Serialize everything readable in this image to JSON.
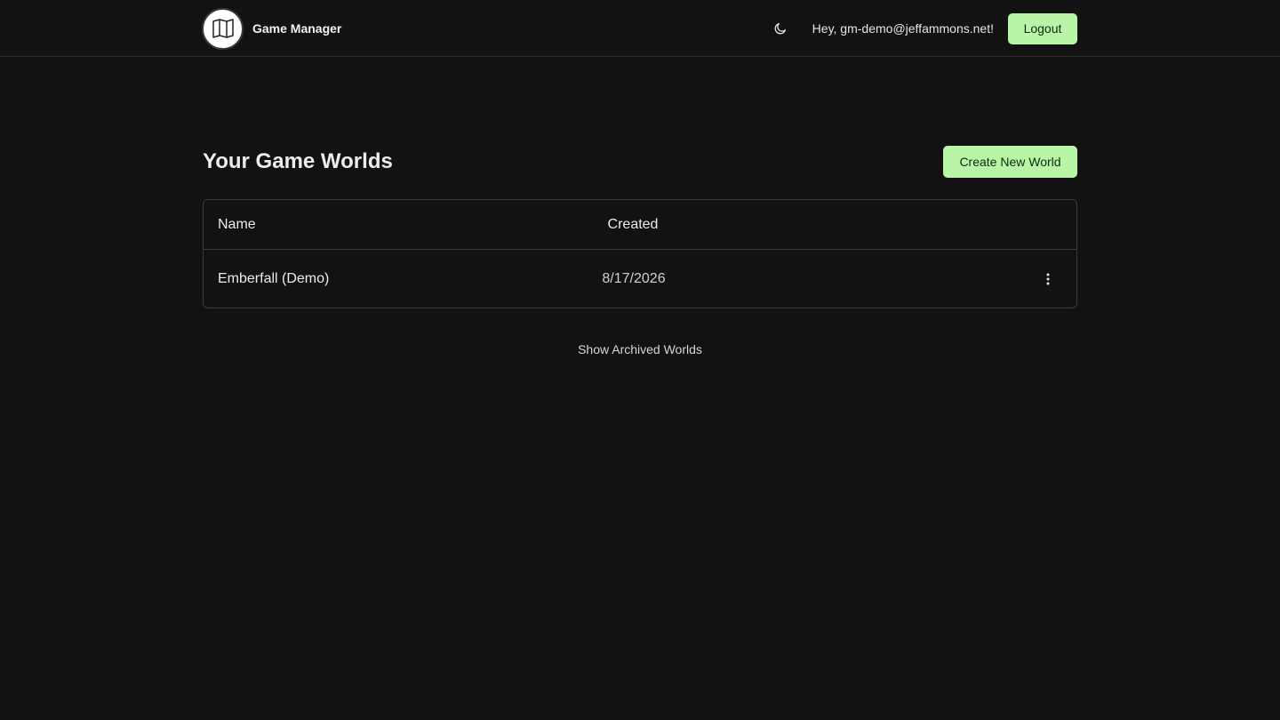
{
  "header": {
    "app_title": "Game Manager",
    "logo_icon": "open-book-icon",
    "theme_icon": "moon-icon",
    "greeting": "Hey, gm-demo@jeffammons.net!",
    "logout_label": "Logout"
  },
  "main": {
    "title": "Your Game Worlds",
    "create_label": "Create New World",
    "table": {
      "columns": [
        "Name",
        "Created"
      ],
      "rows": [
        {
          "name": "Emberfall (Demo)",
          "created": "8/17/2026",
          "menu_icon": "vertical-ellipsis-icon"
        }
      ]
    },
    "show_archived_label": "Show Archived Worlds"
  },
  "colors": {
    "background": "#121212",
    "accent": "#b8f5a6",
    "border": "#3a3a3a"
  }
}
